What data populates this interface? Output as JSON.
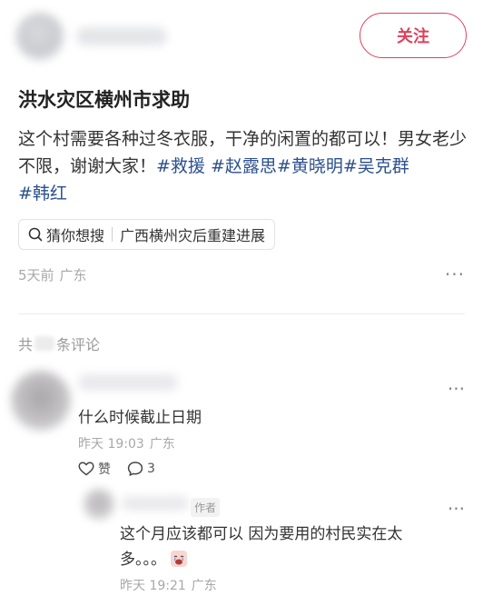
{
  "post": {
    "follow_label": "关注",
    "title": "洪水灾区横州市求助",
    "body_text": "这个村需要各种过冬衣服，干净的闲置的都可以！男女老少不限，谢谢大家！",
    "tags": [
      "#救援",
      "#赵露思",
      "#黄晓明",
      "#吴克群",
      "#韩红"
    ],
    "search_chip": {
      "prefix": "猜你想搜",
      "query": "广西横州灾后重建进展"
    },
    "time": "5天前",
    "location": "广东",
    "more_icon": "more-dots-icon"
  },
  "comments_header": {
    "prefix": "共",
    "suffix": "条评论"
  },
  "comments": [
    {
      "text": "什么时候截止日期",
      "time": "昨天 19:03",
      "location": "广东",
      "like_label": "赞",
      "reply_count": "3"
    },
    {
      "badge": "作者",
      "text": "这个月应该都可以 因为要用的村民实在太多。。。",
      "emoji": "crying-face-icon",
      "time": "昨天 19:21",
      "location": "广东"
    }
  ],
  "colors": {
    "accent": "#e0405a",
    "tag": "#2b4f8f",
    "muted": "#a8a8a8"
  }
}
